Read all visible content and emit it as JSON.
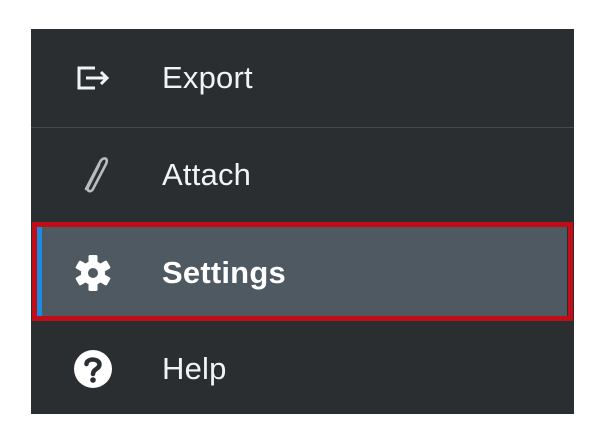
{
  "menu": {
    "items": [
      {
        "label": "Export",
        "icon": "export-icon"
      },
      {
        "label": "Attach",
        "icon": "paperclip-icon"
      },
      {
        "label": "Settings",
        "icon": "gear-icon",
        "selected": true
      },
      {
        "label": "Help",
        "icon": "help-circle-icon"
      }
    ]
  },
  "colors": {
    "panel_background": "#2b2e31",
    "selected_background": "#4f5961",
    "selected_accent": "#1a8de0",
    "highlight_border": "#c10d18",
    "text": "#f1f3f4"
  }
}
